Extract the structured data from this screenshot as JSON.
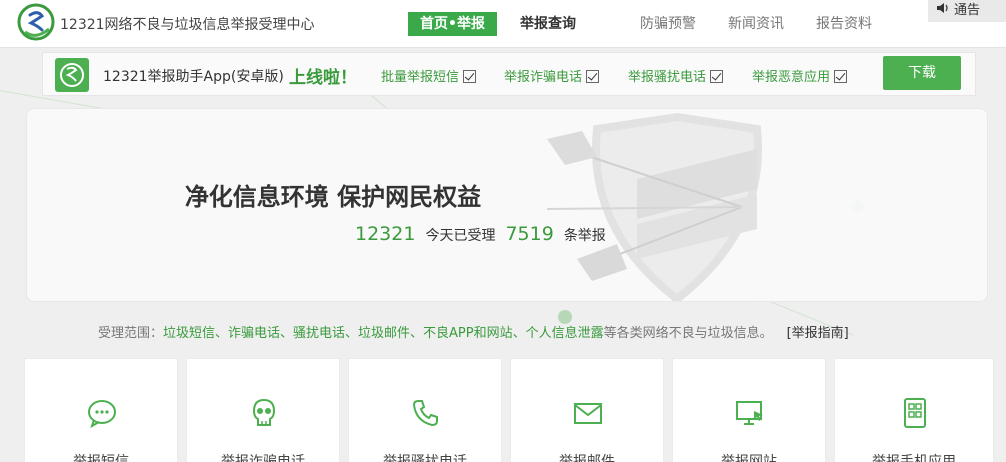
{
  "header": {
    "site_title": "12321网络不良与垃圾信息举报受理中心",
    "nav": [
      {
        "label": "首页•举报"
      },
      {
        "label": "举报查询"
      },
      {
        "label": "防骗预警"
      },
      {
        "label": "新闻资讯"
      },
      {
        "label": "报告资料"
      }
    ],
    "announce_label": "通告",
    "announce_icon": "speaker-icon"
  },
  "app_banner": {
    "app_name": "12321举报助手App(安卓版)",
    "online_text": "上线啦！",
    "features": [
      "批量举报短信",
      "举报诈骗电话",
      "举报骚扰电话",
      "举报恶意应用"
    ],
    "download_label": "下载"
  },
  "hero": {
    "slogan": "净化信息环境 保护网民权益",
    "hotline": "12321",
    "today_label": "今天已受理",
    "today_count": "7519",
    "count_suffix": "条举报"
  },
  "scope": {
    "prefix": "受理范围：",
    "categories_text": "垃圾短信、诈骗电话、骚扰电话、垃圾邮件、不良APP和网站、个人信息泄露",
    "suffix": "等各类网络不良与垃圾信息。",
    "guide_link": "[举报指南]"
  },
  "cards": [
    {
      "label": "举报短信",
      "icon": "sms-bubble-icon"
    },
    {
      "label": "举报诈骗电话",
      "icon": "skull-icon"
    },
    {
      "label": "举报骚扰电话",
      "icon": "phone-icon"
    },
    {
      "label": "举报邮件",
      "icon": "envelope-icon"
    },
    {
      "label": "举报网站",
      "icon": "monitor-cursor-icon"
    },
    {
      "label": "举报手机应用",
      "icon": "app-grid-icon"
    }
  ],
  "colors": {
    "brand_green": "#4caf50",
    "text_green": "#3a9a3c",
    "background": "#efefef"
  }
}
